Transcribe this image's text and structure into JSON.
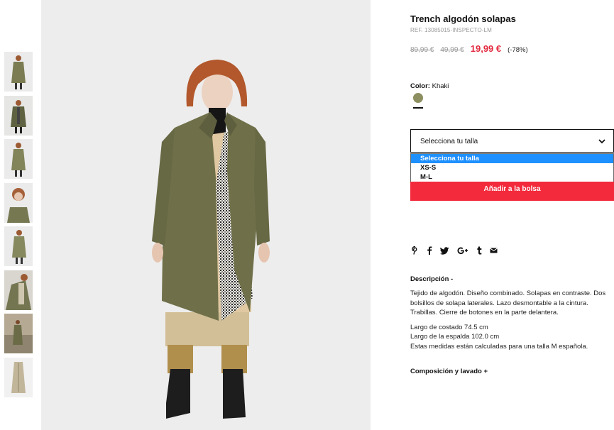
{
  "product": {
    "title": "Trench algodón solapas",
    "ref": "REF. 13085015-INSPECTO-LM",
    "price_original": "89,99 €",
    "price_previous": "49,99 €",
    "price_current": "19,99 €",
    "discount": "(-78%)"
  },
  "color": {
    "label": "Color:",
    "value": "Khaki",
    "swatch_color": "#8d8f60"
  },
  "size": {
    "select_label": "Selecciona tu talla",
    "options": [
      "Selecciona tu talla",
      "XS-S",
      "M-L"
    ]
  },
  "add_to_bag_label": "Añadir a la bolsa",
  "social_icons": [
    "pinterest-icon",
    "facebook-icon",
    "twitter-icon",
    "google-plus-icon",
    "tumblr-icon",
    "email-icon"
  ],
  "description": {
    "heading": "Descripción -",
    "paragraph1": "Tejido de algodón. Diseño combinado. Solapas en contraste. Dos bolsillos de solapa laterales. Lazo desmontable a la cintura. Trabillas. Cierre de botones en la parte delantera.",
    "line1": "Largo de costado 74.5 cm",
    "line2": "Largo de la espalda 102.0 cm",
    "line3": "Estas medidas están calculadas para una talla M española."
  },
  "composition_heading": "Composición y lavado +",
  "colors": {
    "accent_red": "#f22a3c",
    "price_red": "#e22b3f",
    "selection_blue": "#1e90ff"
  }
}
